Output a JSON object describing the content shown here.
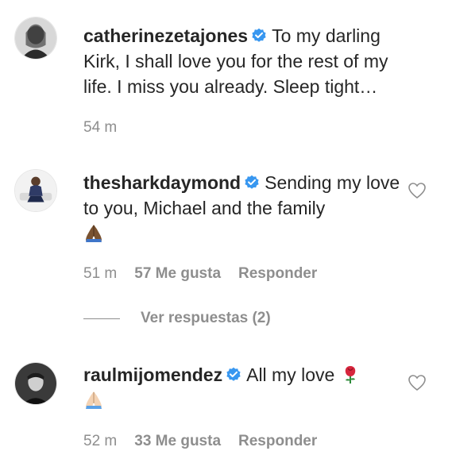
{
  "comments": [
    {
      "username": "catherinezetajones",
      "text": "To my darling Kirk, I shall love you for the rest of my life. I miss you already. Sleep tight…",
      "time": "54 m"
    },
    {
      "username": "thesharkdaymond",
      "text": "Sending my love to you, Michael and the family",
      "emoji": "folded-hands-emoji",
      "time": "51 m",
      "likes": "57 Me gusta",
      "reply_label": "Responder"
    },
    {
      "username": "raulmijomendez",
      "text": "All my love",
      "emoji": "rose-emoji",
      "emoji2": "folded-hands-emoji",
      "time": "52 m",
      "likes": "33 Me gusta",
      "reply_label": "Responder"
    }
  ],
  "view_replies_label": "Ver respuestas (2)",
  "colors": {
    "text": "#262626",
    "muted": "#8e8e8e",
    "verified": "#3897f0"
  }
}
